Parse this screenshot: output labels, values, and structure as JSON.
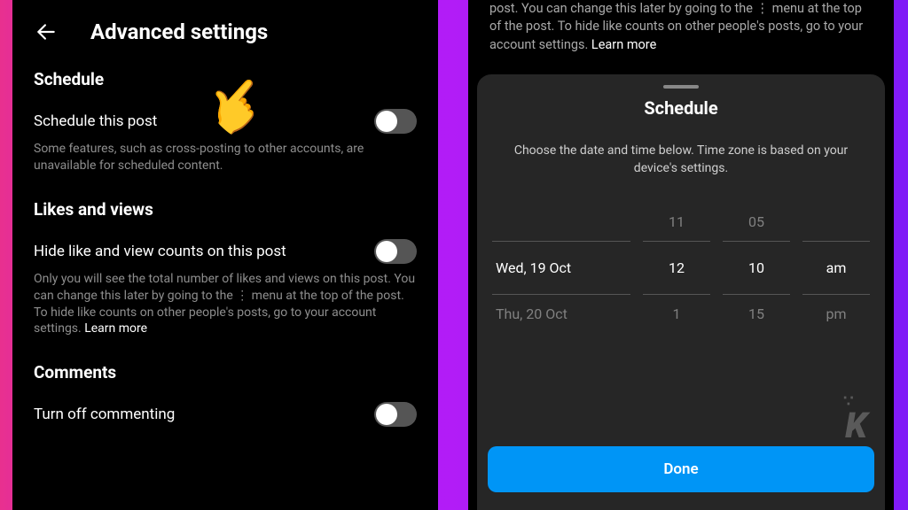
{
  "left": {
    "title": "Advanced settings",
    "schedule": {
      "heading": "Schedule",
      "toggle_label": "Schedule this post",
      "desc": "Some features, such as cross-posting to other accounts, are unavailable for scheduled content."
    },
    "likes": {
      "heading": "Likes and views",
      "toggle_label": "Hide like and view counts on this post",
      "desc": "Only you will see the total number of likes and views on this post. You can change this later by going to the ⋮ menu at the top of the post. To hide like counts on other people's posts, go to your account settings. ",
      "learn_more": "Learn more"
    },
    "comments": {
      "heading": "Comments",
      "toggle_label": "Turn off commenting"
    },
    "emoji": "👈"
  },
  "right": {
    "top_partial": "post. You can change this later by going to the ⋮ menu at the top of the post. To hide like counts on other people's posts, go to your account settings. ",
    "learn_more": "Learn more",
    "sheet_title": "Schedule",
    "sheet_sub": "Choose the date and time below. Time zone is based on your device's settings.",
    "picker": {
      "prev": {
        "date": "",
        "hour": "11",
        "minute": "05",
        "ampm": ""
      },
      "sel": {
        "date": "Wed, 19 Oct",
        "hour": "12",
        "minute": "10",
        "ampm": "am"
      },
      "next": {
        "date": "Thu, 20 Oct",
        "hour": "1",
        "minute": "15",
        "ampm": "pm"
      }
    },
    "done": "Done"
  }
}
